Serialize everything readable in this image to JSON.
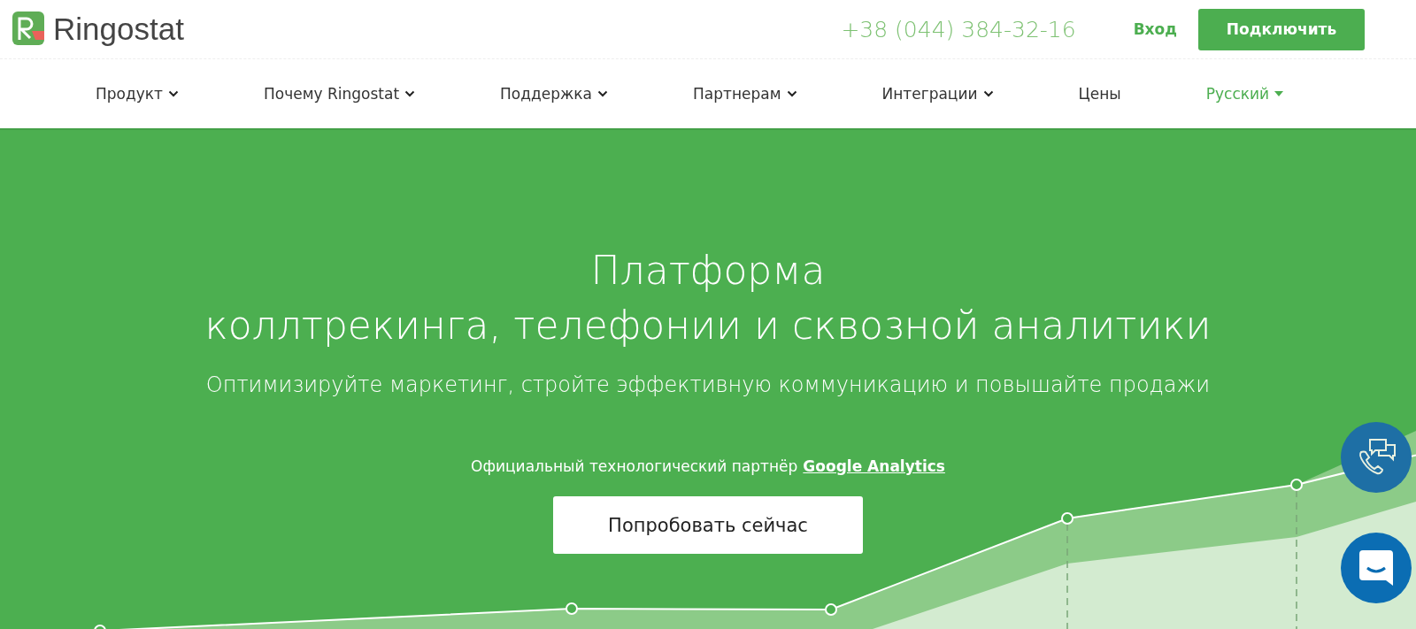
{
  "header": {
    "logo_text": "Ringostat",
    "phone": "+38 (044) 384-32-16",
    "login": "Вход",
    "cta": "Подключить"
  },
  "nav": {
    "items": [
      {
        "label": "Продукт",
        "has_menu": true
      },
      {
        "label": "Почему Ringostat",
        "has_menu": true
      },
      {
        "label": "Поддержка",
        "has_menu": true
      },
      {
        "label": "Партнерам",
        "has_menu": true
      },
      {
        "label": "Интеграции",
        "has_menu": true
      },
      {
        "label": "Цены",
        "has_menu": false
      }
    ],
    "language": "Русский"
  },
  "hero": {
    "title_lines": [
      "Платформа",
      "коллтрекинга, телефонии и сквозной аналитики"
    ],
    "subtitle": "Оптимизируйте маркетинг, стройте эффективную коммуникацию и повышайте продажи",
    "partner_text": "Официальный технологический партнёр",
    "partner_link": "Google Analytics",
    "button": "Попробовать сейчас"
  }
}
